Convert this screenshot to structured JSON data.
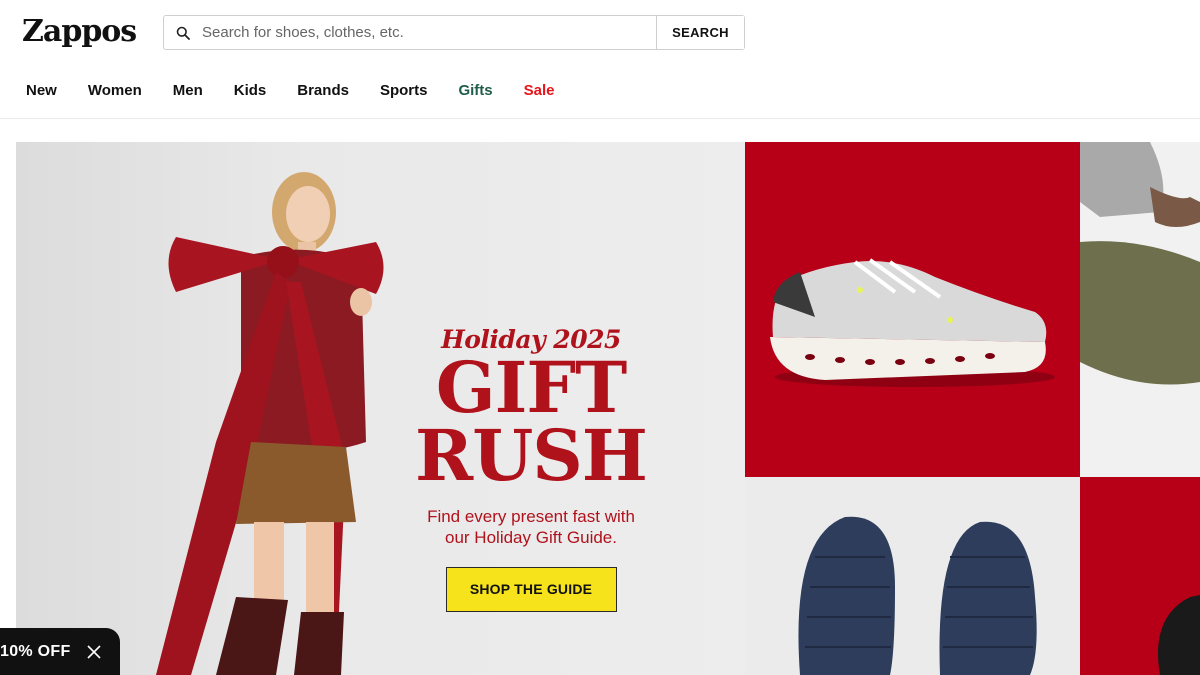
{
  "header": {
    "logo": "Zappos",
    "search_placeholder": "Search for shoes, clothes, etc.",
    "search_button": "SEARCH"
  },
  "nav": {
    "items": [
      "New",
      "Women",
      "Men",
      "Kids",
      "Brands",
      "Sports",
      "Gifts",
      "Sale"
    ]
  },
  "hero": {
    "subtitle": "Holiday 2025",
    "title_line1": "GIFT",
    "title_line2": "RUSH",
    "description_line1": "Find every present fast with",
    "description_line2": "our Holiday Gift Guide.",
    "cta": "SHOP THE GUIDE"
  },
  "badge": {
    "text": "10% OFF"
  },
  "colors": {
    "brand_red": "#b0121c",
    "tile_red": "#b70018",
    "cta_yellow": "#f6e31c",
    "gifts_green": "#1f5d4a",
    "sale_red": "#e8141c"
  }
}
